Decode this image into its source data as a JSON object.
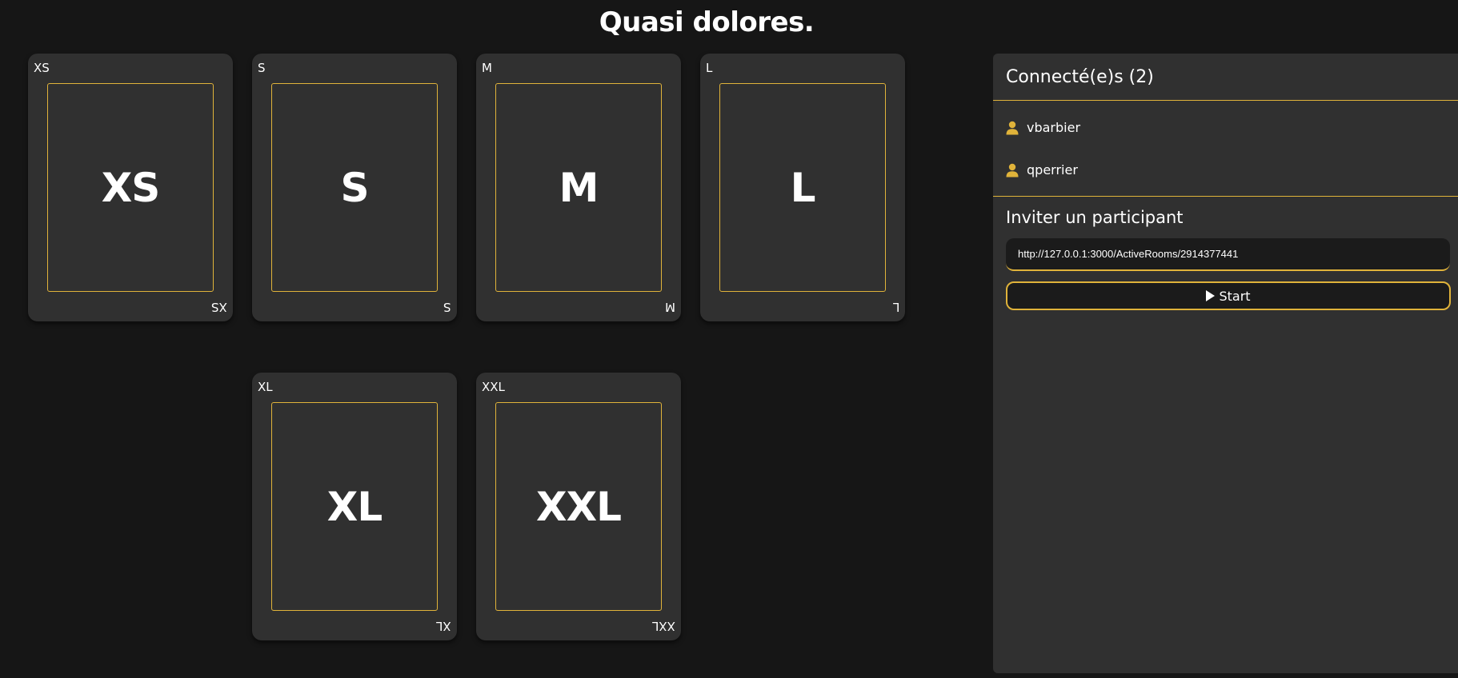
{
  "page": {
    "title": "Quasi dolores."
  },
  "cards": [
    {
      "label": "XS"
    },
    {
      "label": "S"
    },
    {
      "label": "M"
    },
    {
      "label": "L"
    },
    {
      "label": "XL"
    },
    {
      "label": "XXL"
    }
  ],
  "panel": {
    "connected_title": "Connecté(e)s (2)",
    "users": [
      {
        "name": "vbarbier",
        "icon": "user-icon"
      },
      {
        "name": "qperrier",
        "icon": "user-icon"
      }
    ],
    "invite_title": "Inviter un participant",
    "invite_link": "http://127.0.0.1:3000/ActiveRooms/2914377441",
    "start_label": "Start",
    "start_icon": "play-icon"
  },
  "colors": {
    "background": "#161616",
    "card": "#303030",
    "accent": "#e0b33a"
  }
}
